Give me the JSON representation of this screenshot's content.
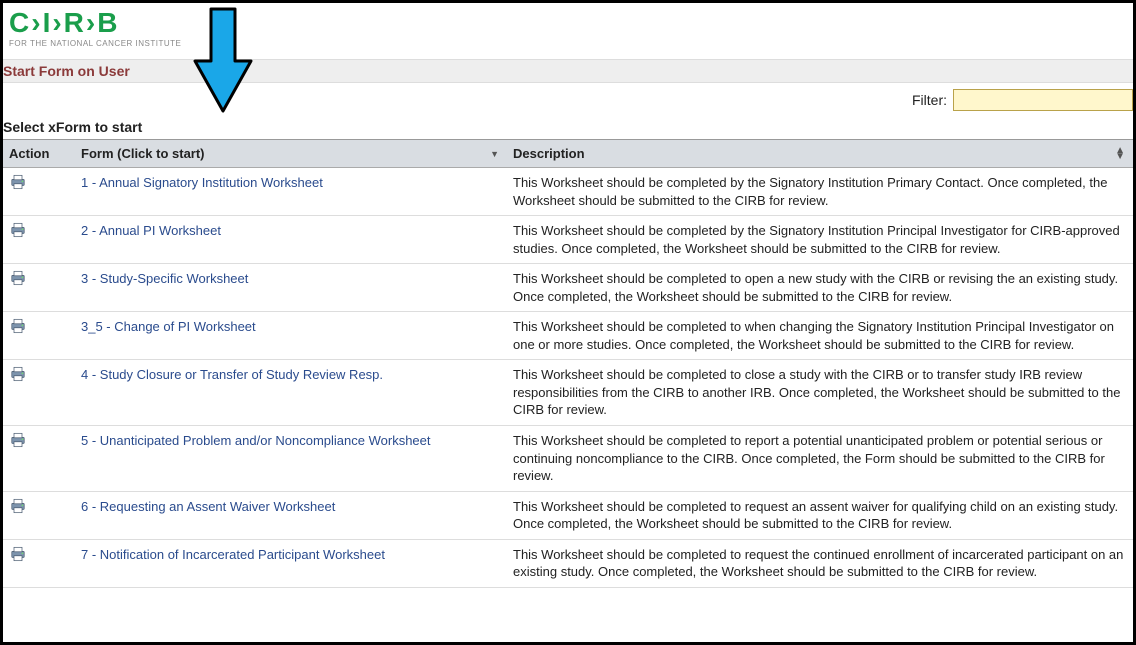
{
  "logo": {
    "text": "C›I›R›B",
    "subtitle": "FOR THE NATIONAL CANCER INSTITUTE"
  },
  "breadcrumb": "Start Form on User",
  "filter": {
    "label": "Filter:",
    "value": ""
  },
  "section_heading": "Select xForm to start",
  "columns": {
    "action": "Action",
    "form": "Form (Click to start)",
    "description": "Description"
  },
  "rows": [
    {
      "form": "1 - Annual Signatory Institution Worksheet",
      "description": "This Worksheet should be completed by the Signatory Institution Primary Contact. Once completed, the Worksheet should be submitted to the CIRB for review."
    },
    {
      "form": "2 - Annual PI Worksheet",
      "description": "This Worksheet should be completed by the Signatory Institution Principal Investigator for CIRB-approved studies. Once completed, the Worksheet should be submitted to the CIRB for review."
    },
    {
      "form": "3 - Study-Specific Worksheet",
      "description": "This Worksheet should be completed to open a new study with the CIRB or revising the an existing study. Once completed, the Worksheet should be submitted to the CIRB for review."
    },
    {
      "form": "3_5 - Change of PI Worksheet",
      "description": "This Worksheet should be completed to when changing the Signatory Institution Principal Investigator on one or more studies. Once completed, the Worksheet should be submitted to the CIRB for review."
    },
    {
      "form": "4 - Study Closure or Transfer of Study Review Resp.",
      "description": "This Worksheet should be completed to close a study with the CIRB or to transfer study IRB review responsibilities from the CIRB to another IRB. Once completed, the Worksheet should be submitted to the CIRB for review."
    },
    {
      "form": "5 - Unanticipated Problem and/or Noncompliance Worksheet",
      "description": "This Worksheet should be completed to report a potential unanticipated problem or potential serious or continuing noncompliance to the CIRB. Once completed, the Form should be submitted to the CIRB for review."
    },
    {
      "form": "6 - Requesting an Assent Waiver Worksheet",
      "description": "This Worksheet should be completed to request an assent waiver for qualifying child on an existing study. Once completed, the Worksheet should be submitted to the CIRB for review."
    },
    {
      "form": "7 - Notification of Incarcerated Participant Worksheet",
      "description": "This Worksheet should be completed to request the continued enrollment of incarcerated participant on an existing study. Once completed, the Worksheet should be submitted to the CIRB for review."
    }
  ]
}
